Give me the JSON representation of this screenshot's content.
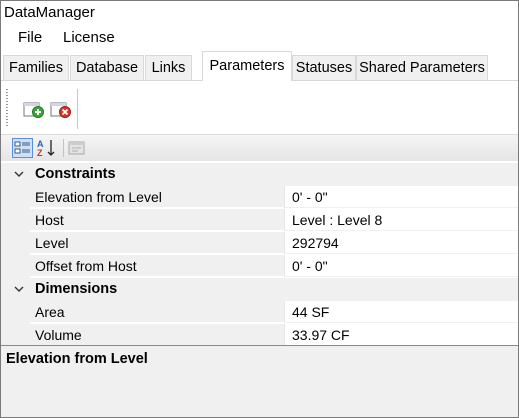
{
  "window": {
    "title": "DataManager"
  },
  "menu": {
    "items": [
      "File",
      "License"
    ]
  },
  "tabs": [
    {
      "label": "Families",
      "active": false
    },
    {
      "label": "Database",
      "active": false
    },
    {
      "label": "Links",
      "active": false
    },
    {
      "label": "Parameters",
      "active": true
    },
    {
      "label": "Statuses",
      "active": false
    },
    {
      "label": "Shared Parameters",
      "active": false
    }
  ],
  "toolbar": {
    "add_icon": "add-parameter-icon",
    "delete_icon": "delete-parameter-icon"
  },
  "grid_toolbar": {
    "categorized_icon": "categorized-view-icon",
    "alphabetical_icon": "sort-alphabetical-icon",
    "property_pages_icon": "property-pages-icon"
  },
  "property_grid": {
    "categories": [
      {
        "name": "Constraints",
        "expanded": true,
        "properties": [
          {
            "name": "Elevation from Level",
            "value": "0' - 0\""
          },
          {
            "name": "Host",
            "value": "Level : Level 8"
          },
          {
            "name": "Level",
            "value": "292794"
          },
          {
            "name": "Offset from Host",
            "value": "0' - 0\""
          }
        ]
      },
      {
        "name": "Dimensions",
        "expanded": true,
        "properties": [
          {
            "name": "Area",
            "value": "44 SF"
          },
          {
            "name": "Volume",
            "value": "33.97 CF"
          }
        ]
      }
    ]
  },
  "description": {
    "title": "Elevation from Level"
  },
  "colors": {
    "accent": "#0078d7",
    "add_green": "#3aa63a",
    "delete_red": "#d9342b"
  }
}
